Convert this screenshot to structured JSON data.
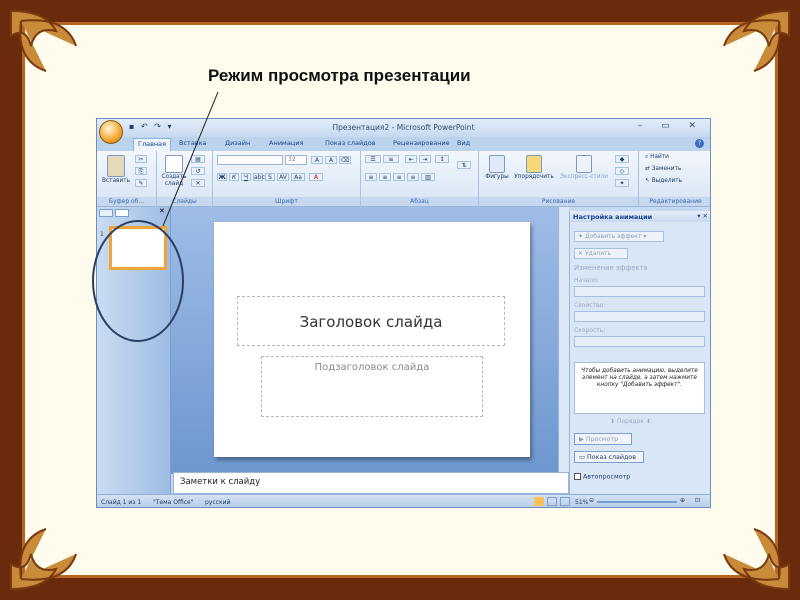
{
  "caption": "Режим просмотра презентации",
  "window": {
    "title": "Презентация2 - Microsoft PowerPoint",
    "tabs": [
      "Главная",
      "Вставка",
      "Дизайн",
      "Анимация",
      "Показ слайдов",
      "Рецензирование",
      "Вид"
    ]
  },
  "ribbon": {
    "paste": "Вставить",
    "new_slide": "Создать слайд",
    "font_size": "32",
    "shapes": "Фигуры",
    "arrange": "Упорядочить",
    "quick_styles": "Экспресс-стили",
    "find": "Найти",
    "replace": "Заменить",
    "select": "Выделить",
    "groups": [
      "Буфер об...",
      "Слайды",
      "Шрифт",
      "Абзац",
      "Рисование",
      "Редактирование"
    ]
  },
  "thumb_pane": {
    "slide_number": "1"
  },
  "slide": {
    "title_placeholder": "Заголовок слайда",
    "subtitle_placeholder": "Подзаголовок слайда"
  },
  "notes_placeholder": "Заметки к слайду",
  "task_pane": {
    "title": "Настройка анимации",
    "add_effect": "Добавить эффект",
    "remove": "Удалить",
    "change_effect": "Изменение эффекта",
    "start_label": "Начало:",
    "property_label": "Свойство:",
    "speed_label": "Скорость:",
    "hint": "Чтобы добавить анимацию, выделите элемент на слайде, а затем нажмите кнопку \"Добавить эффект\".",
    "order": "Порядок",
    "preview": "Просмотр",
    "slideshow": "Показ слайдов",
    "autopreview": "Автопросмотр"
  },
  "status": {
    "slide": "Слайд 1 из 1",
    "theme": "\"Тема Office\"",
    "language": "русский",
    "zoom": "51%"
  }
}
